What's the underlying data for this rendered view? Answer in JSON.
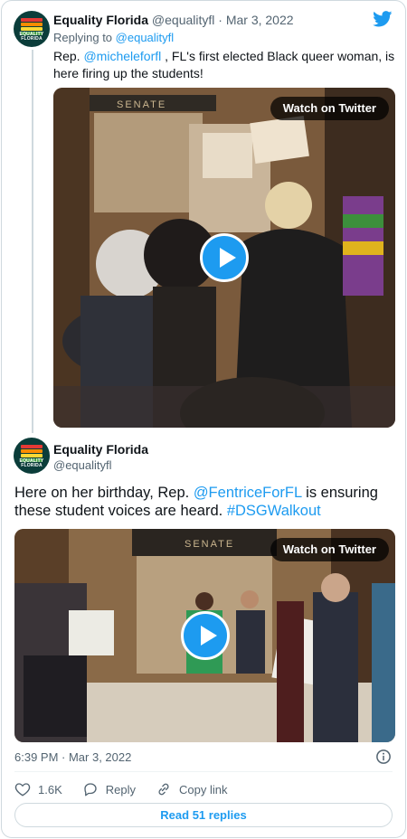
{
  "parent_tweet": {
    "author_name": "Equality Florida",
    "author_handle": "@equalityfl",
    "separator": "·",
    "date": "Mar 3, 2022",
    "reply_prefix": "Replying to ",
    "reply_handle": "@equalityfl",
    "text_prefix": "Rep. ",
    "mention": "@micheleforfl",
    "text_suffix": " , FL's first elected Black queer woman, is here firing up the students!",
    "media": {
      "watch_label": "Watch on Twitter",
      "sign_text": "SENATE"
    }
  },
  "avatar_text": "EQUALITY FLORIDA",
  "main_tweet": {
    "author_name": "Equality Florida",
    "author_handle": "@equalityfl",
    "text_part1": "Here on her birthday, Rep. ",
    "mention": "@FentriceForFL",
    "text_part2": " is ensuring these student voices are heard. ",
    "hashtag": "#DSGWalkout",
    "media": {
      "watch_label": "Watch on Twitter",
      "sign_text": "SENATE"
    },
    "timestamp": "6:39 PM · Mar 3, 2022"
  },
  "actions": {
    "like_count": "1.6K",
    "reply_label": "Reply",
    "copy_label": "Copy link"
  },
  "read_replies_label": "Read 51 replies",
  "colors": {
    "accent": "#1d9bf0",
    "text": "#0f1419",
    "muted": "#536471",
    "border": "#cfd9de",
    "avatar_bg": "#0b3d3a"
  },
  "icons": [
    "twitter-bird-icon",
    "play-icon",
    "info-icon",
    "heart-icon",
    "reply-bubble-icon",
    "link-icon"
  ]
}
